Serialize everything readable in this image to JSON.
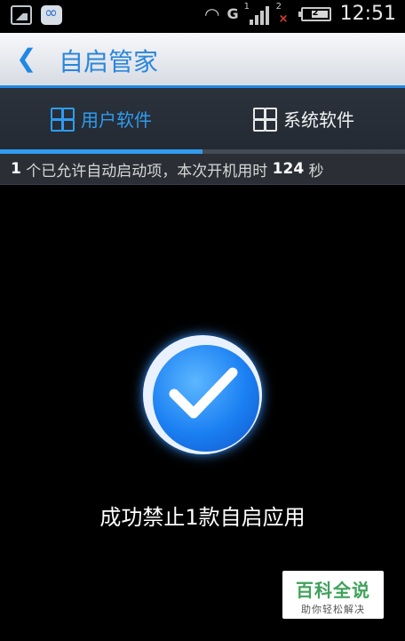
{
  "status_bar": {
    "network_type": "G",
    "sim1_label": "1",
    "sim2_label": "2",
    "battery_level": "32",
    "time": "12:51"
  },
  "header": {
    "back_symbol": "❮",
    "title": "自启管家"
  },
  "tabs": [
    {
      "label": "用户软件",
      "selected": true
    },
    {
      "label": "系统软件",
      "selected": false
    }
  ],
  "info_bar": {
    "count": "1",
    "text_a": " 个已允许自动启动项，本次开机用时 ",
    "seconds": "124",
    "text_b": " 秒"
  },
  "result": {
    "message": "成功禁止1款自启应用"
  },
  "watermark": {
    "title": "百科全说",
    "subtitle": "助你轻松解决"
  },
  "colors": {
    "accent": "#1f87e4",
    "tab_selected": "#2f9cf0",
    "background": "#000000",
    "watermark_green": "#3fa25a"
  }
}
